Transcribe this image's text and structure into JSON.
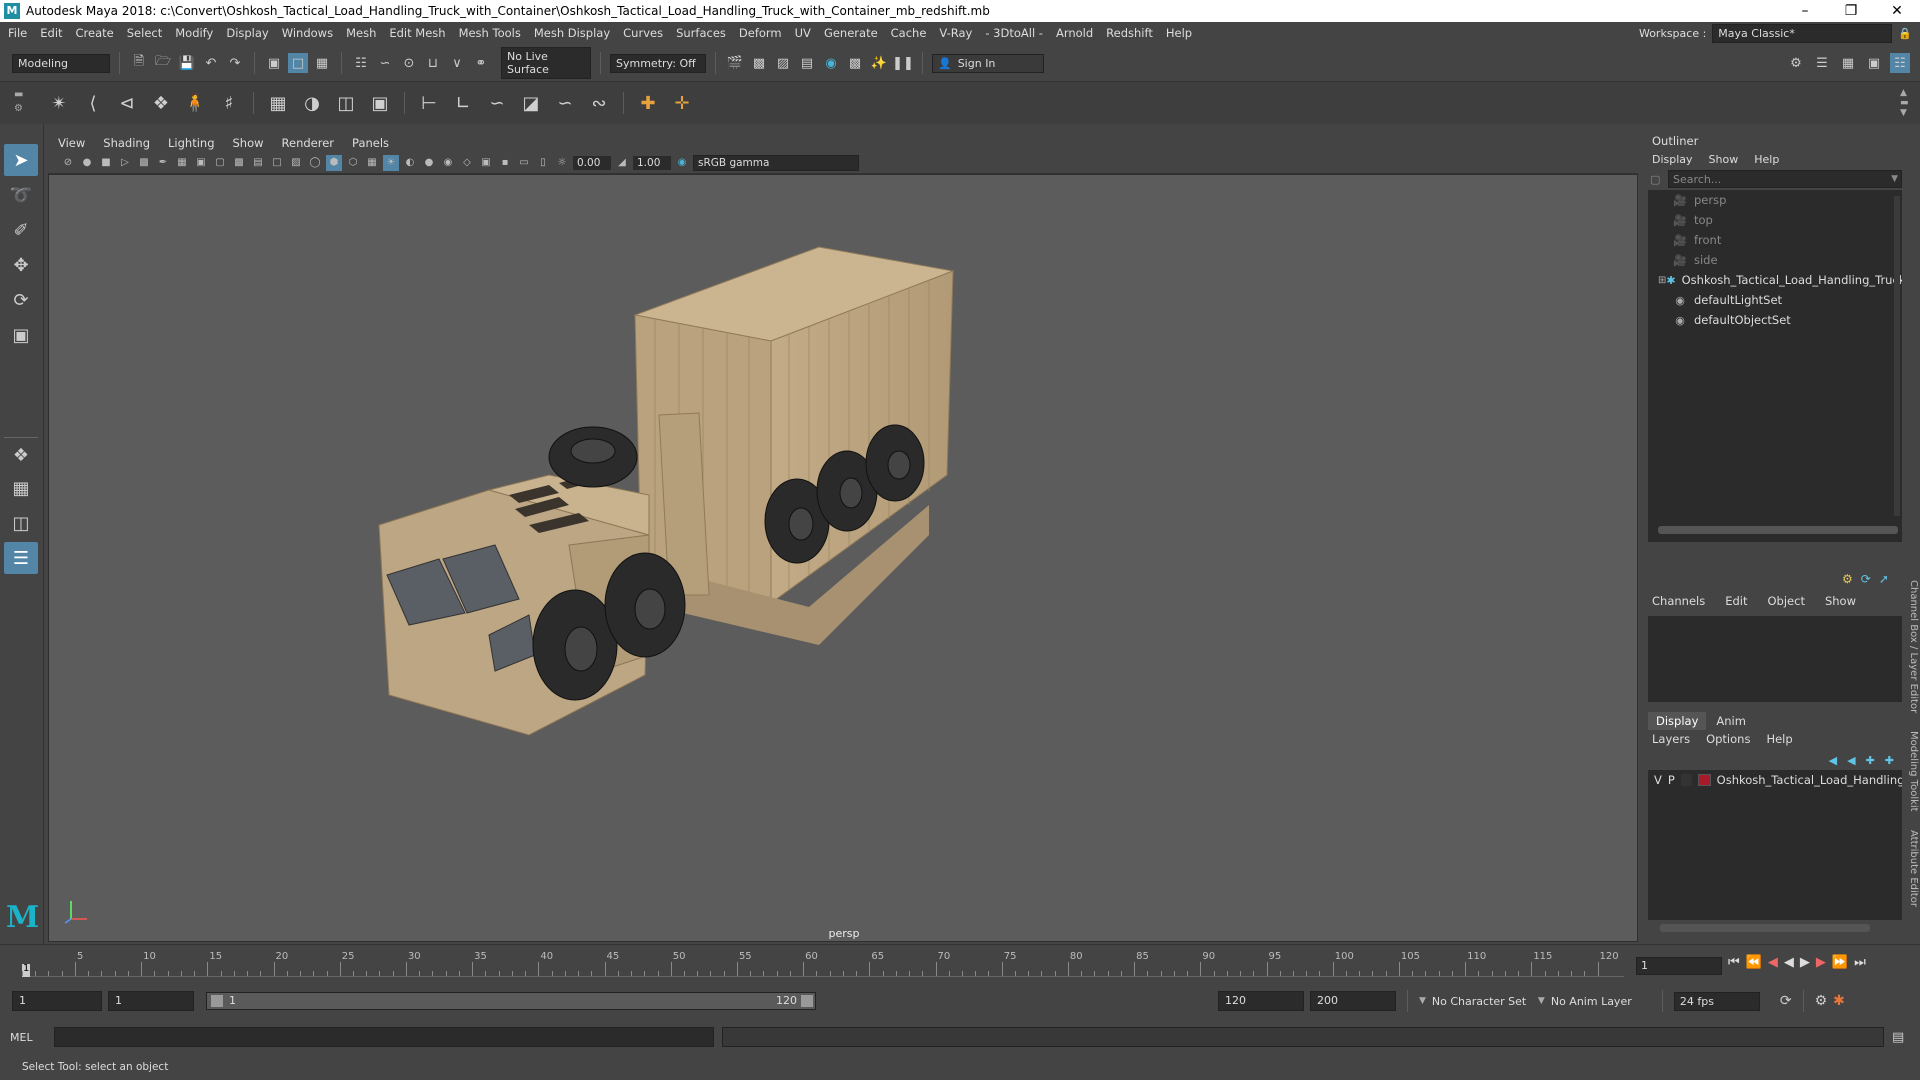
{
  "window": {
    "title": "Autodesk Maya 2018: c:\\Convert\\Oshkosh_Tactical_Load_Handling_Truck_with_Container\\Oshkosh_Tactical_Load_Handling_Truck_with_Container_mb_redshift.mb"
  },
  "menu": [
    "File",
    "Edit",
    "Create",
    "Select",
    "Modify",
    "Display",
    "Windows",
    "Mesh",
    "Edit Mesh",
    "Mesh Tools",
    "Mesh Display",
    "Curves",
    "Surfaces",
    "Deform",
    "UV",
    "Generate",
    "Cache",
    "V-Ray",
    "- 3DtoAll -",
    "Arnold",
    "Redshift",
    "Help"
  ],
  "workspace": {
    "label": "Workspace :",
    "value": "Maya Classic*"
  },
  "status": {
    "mode": "Modeling",
    "live_surface": "No Live Surface",
    "symmetry": "Symmetry: Off",
    "sign_in": "Sign In"
  },
  "panel_menu": [
    "View",
    "Shading",
    "Lighting",
    "Show",
    "Renderer",
    "Panels"
  ],
  "panel_tools": {
    "exposure": "0.00",
    "gamma": "1.00",
    "color_space": "sRGB gamma"
  },
  "viewport": {
    "camera": "persp",
    "bg": "#5c5c5c"
  },
  "outliner": {
    "title": "Outliner",
    "menu": [
      "Display",
      "Show",
      "Help"
    ],
    "search_placeholder": "Search...",
    "items": [
      {
        "label": "persp",
        "icon": "camera-icon",
        "dim": true
      },
      {
        "label": "top",
        "icon": "camera-icon",
        "dim": true
      },
      {
        "label": "front",
        "icon": "camera-icon",
        "dim": true
      },
      {
        "label": "side",
        "icon": "camera-icon",
        "dim": true
      },
      {
        "label": "Oshkosh_Tactical_Load_Handling_Truck_",
        "icon": "group-icon",
        "dim": false
      },
      {
        "label": "defaultLightSet",
        "icon": "set-icon",
        "dim": false
      },
      {
        "label": "defaultObjectSet",
        "icon": "set-icon",
        "dim": false
      }
    ]
  },
  "channel_box": {
    "menu": [
      "Channels",
      "Edit",
      "Object",
      "Show"
    ]
  },
  "layer_editor": {
    "tabs": [
      "Display",
      "Anim"
    ],
    "menu": [
      "Layers",
      "Options",
      "Help"
    ],
    "layer": {
      "v": "V",
      "p": "P",
      "name": "Oshkosh_Tactical_Load_Handling_Tr",
      "color": "#a81a2a"
    }
  },
  "side_tabs": [
    "Channel Box / Layer Editor",
    "Modeling Toolkit",
    "Attribute Editor"
  ],
  "timeline": {
    "ticks": [
      "5",
      "10",
      "15",
      "20",
      "25",
      "30",
      "35",
      "40",
      "45",
      "50",
      "55",
      "60",
      "65",
      "70",
      "75",
      "80",
      "85",
      "90",
      "95",
      "100",
      "105",
      "110",
      "115",
      "120"
    ],
    "start_label": "1",
    "current_frame": "1"
  },
  "range": {
    "start": "1",
    "playback_start": "1",
    "slider_start": "1",
    "slider_end": "120",
    "playback_end": "120",
    "end": "200",
    "character_set": "No Character Set",
    "anim_layer": "No Anim Layer",
    "fps": "24 fps"
  },
  "command": {
    "lang": "MEL"
  },
  "help_line": "Select Tool: select an object"
}
